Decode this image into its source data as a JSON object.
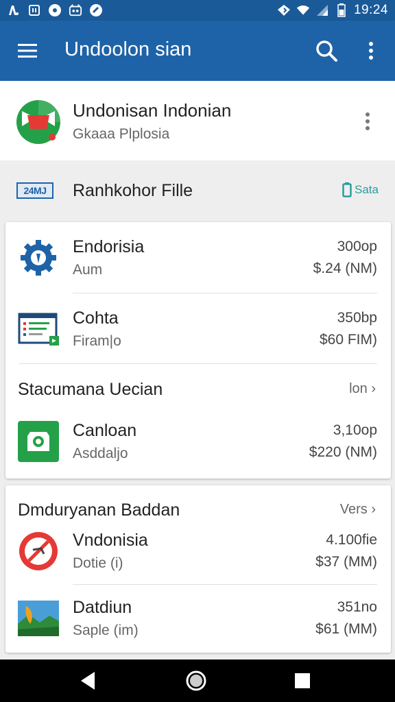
{
  "status_bar": {
    "time": "19:24",
    "left_icons": [
      "notification-icon",
      "notification-icon",
      "notification-icon",
      "notification-icon",
      "notification-icon"
    ],
    "right_icons": [
      "signal-icon",
      "wifi-icon",
      "cell-icon",
      "battery-icon"
    ]
  },
  "app_bar": {
    "title": "Undoolon sian",
    "icons": [
      "menu-icon",
      "search-icon",
      "more-vert-icon"
    ]
  },
  "profile": {
    "name": "Undonisan Indonian",
    "subtitle": "Gkaaa Plplosia"
  },
  "section": {
    "badge": "24MJ",
    "title": "Ranhkohor Fille",
    "action": "Sata"
  },
  "card1": {
    "items": [
      {
        "title": "Endorisia",
        "subtitle": "Aum",
        "value": "300op",
        "price": "$.24 (NM)",
        "icon": "gear-icon"
      },
      {
        "title": "Cohta",
        "subtitle": "Firam|o",
        "value": "350bp",
        "price": "$60 FIM)",
        "icon": "document-icon"
      }
    ],
    "subheader": {
      "title": "Stacumana Uecian",
      "action": "lon ›"
    },
    "items2": [
      {
        "title": "Canloan",
        "subtitle": "Asddaljo",
        "value": "3,10op",
        "price": "$220 (NM)",
        "icon": "camera-icon"
      }
    ]
  },
  "card2": {
    "subheader": {
      "title": "Dmduryanan Baddan",
      "action": "Vers ›"
    },
    "items": [
      {
        "title": "Vndonisia",
        "subtitle": "Dotie (i)",
        "value": "4.100fie",
        "price": "$37 (MM)",
        "icon": "no-entry-icon"
      },
      {
        "title": "Datdiun",
        "subtitle": "Saple (im)",
        "value": "351no",
        "price": "$61 (MM)",
        "icon": "landscape-icon"
      }
    ]
  },
  "colors": {
    "status_bar": "#1a5a99",
    "app_bar": "#1e63a8",
    "accent": "#2a9d9d",
    "green": "#24a148",
    "red": "#e53935"
  }
}
